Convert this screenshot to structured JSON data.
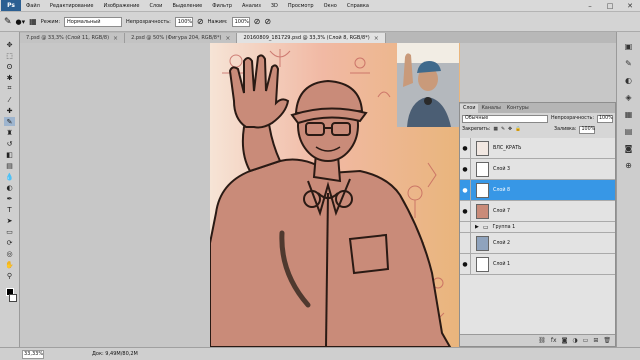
{
  "app": {
    "logo": "Ps"
  },
  "menu": [
    "Файл",
    "Редактирование",
    "Изображение",
    "Слои",
    "Выделение",
    "Фильтр",
    "Анализ",
    "3D",
    "Просмотр",
    "Окно",
    "Справка"
  ],
  "options": {
    "mode_label": "Режим:",
    "mode_value": "Нормальный",
    "opacity_label": "Непрозрачность:",
    "opacity_value": "100%",
    "flow_label": "Нажим:",
    "flow_value": "100%"
  },
  "doc_tabs": [
    {
      "label": "7.psd @ 33,3% (Слой 11, RGB/8)"
    },
    {
      "label": "2.psd @ 50% (Фигура 204, RGB/8*)"
    },
    {
      "label": "20160809_181729.psd @ 33,3% (Слой 8, RGB/8*)"
    }
  ],
  "layers_panel": {
    "tabs": [
      "Слои",
      "Каналы",
      "Контуры"
    ],
    "blend_mode": "Обычные",
    "opacity_label": "Непрозрачность:",
    "opacity_value": "100%",
    "lock_label": "Закрепить:",
    "fill_label": "Заливка:",
    "fill_value": "100%",
    "layers": [
      {
        "name": "ВЛС_КРАТЬ"
      },
      {
        "name": "Слой 3"
      },
      {
        "name": "Слой 8"
      },
      {
        "name": "Слой 7"
      },
      {
        "name": "Группа 1"
      },
      {
        "name": "Слой 2"
      },
      {
        "name": "Слой 1"
      }
    ]
  },
  "status": {
    "zoom": "33,33%",
    "doc_info": "Док: 9,49M/80,2M"
  },
  "colors": {
    "accent": "#3797e6",
    "skin": "#c98b79",
    "line": "#2a1a14"
  }
}
